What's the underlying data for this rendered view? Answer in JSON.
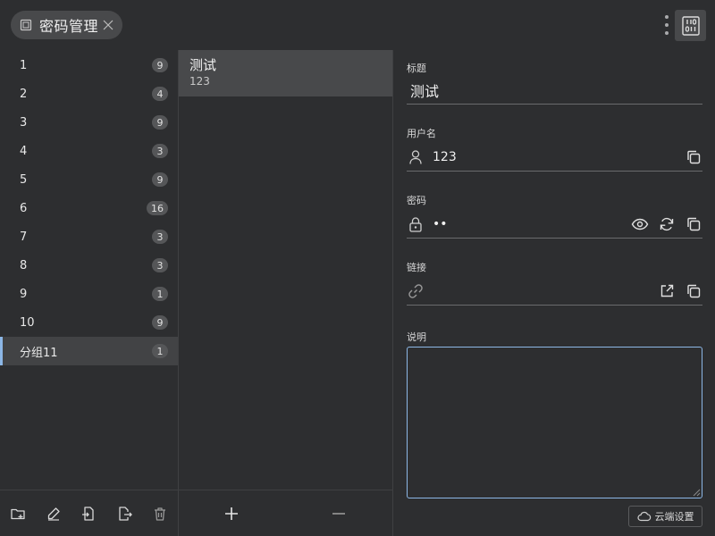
{
  "app": {
    "title": "密码管理",
    "icon": "app-window-icon",
    "close_icon": "close-icon",
    "menu_icon": "more-vertical-icon",
    "panel_icon": "binary-icon"
  },
  "groups": {
    "items": [
      {
        "label": "1",
        "count": "9"
      },
      {
        "label": "2",
        "count": "4"
      },
      {
        "label": "3",
        "count": "9"
      },
      {
        "label": "4",
        "count": "3"
      },
      {
        "label": "5",
        "count": "9"
      },
      {
        "label": "6",
        "count": "16"
      },
      {
        "label": "7",
        "count": "3"
      },
      {
        "label": "8",
        "count": "3"
      },
      {
        "label": "9",
        "count": "1"
      },
      {
        "label": "10",
        "count": "9"
      },
      {
        "label": "分组11",
        "count": "1",
        "active": true
      }
    ],
    "footer_icons": [
      "folder-add-icon",
      "edit-icon",
      "import-icon",
      "export-icon",
      "trash-icon"
    ]
  },
  "entries": {
    "items": [
      {
        "title": "测试",
        "subtitle": "123",
        "selected": true
      }
    ],
    "footer_icons": [
      "plus-icon",
      "minus-icon"
    ]
  },
  "details": {
    "title": {
      "label": "标题",
      "value": "测试"
    },
    "username": {
      "label": "用户名",
      "value": "123",
      "icon": "user-icon",
      "actions": [
        "copy-icon"
      ]
    },
    "password": {
      "label": "密码",
      "value": "••",
      "icon": "lock-icon",
      "actions": [
        "eye-icon",
        "refresh-icon",
        "copy-icon"
      ]
    },
    "link": {
      "label": "链接",
      "value": "",
      "icon": "link-icon",
      "actions": [
        "external-link-icon",
        "copy-icon"
      ]
    },
    "note": {
      "label": "说明",
      "value": ""
    },
    "cloud_button": {
      "label": "云端设置",
      "icon": "cloud-icon"
    }
  },
  "colors": {
    "background": "#2d2e30",
    "selected": "#48494b",
    "accent": "#8cb7e6"
  }
}
